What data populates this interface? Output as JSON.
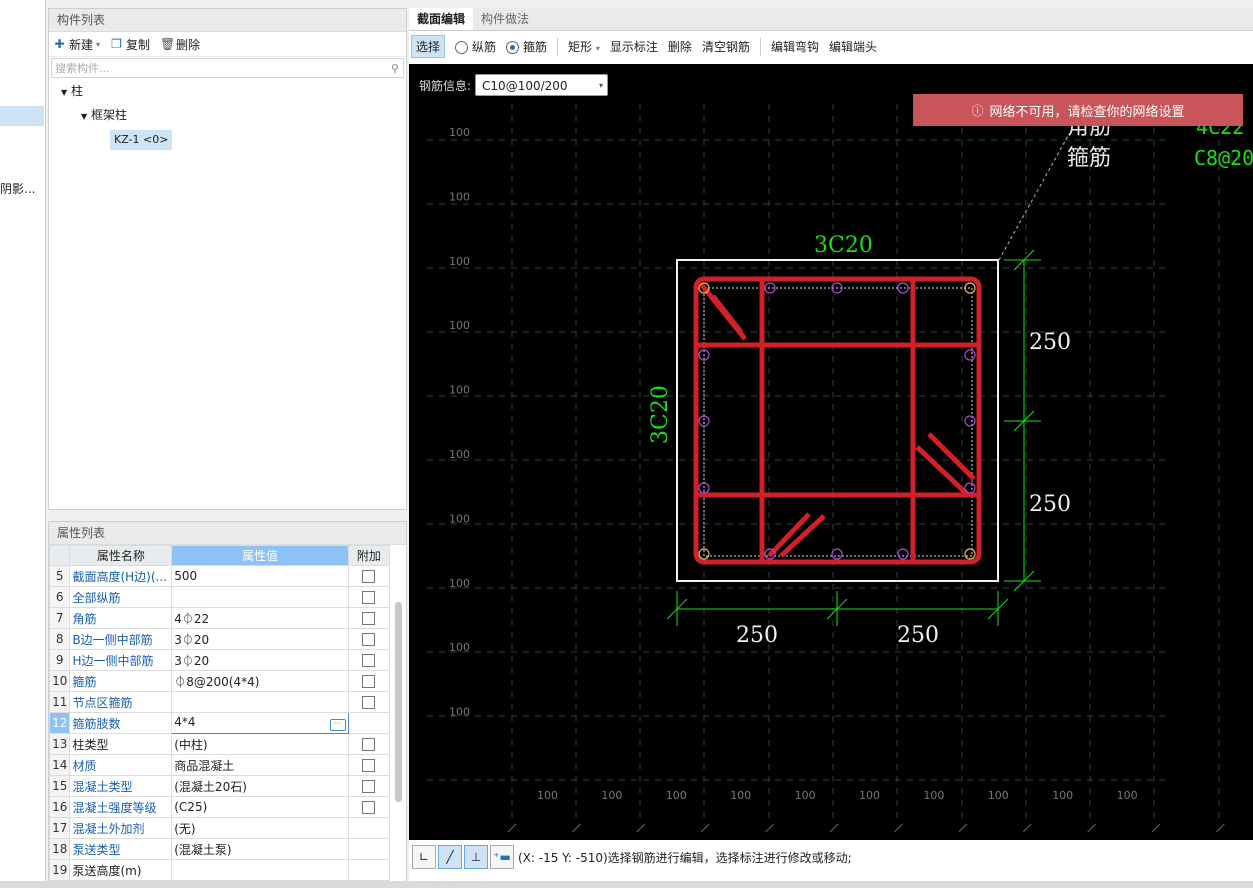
{
  "left_strip": {
    "text": "阴影..."
  },
  "component_list": {
    "title": "构件列表",
    "toolbar": {
      "new": "新建",
      "copy": "复制",
      "delete": "删除"
    },
    "search_placeholder": "搜索构件...",
    "tree": {
      "root": "柱",
      "child": "框架柱",
      "leaf": "KZ-1 <0>"
    }
  },
  "property_list": {
    "title": "属性列表",
    "headers": {
      "name": "属性名称",
      "value": "属性值",
      "extra": "附加"
    },
    "rows": [
      {
        "n": "5",
        "name": "截面高度(H边)(...",
        "value": "500",
        "checkbox": true,
        "link": true
      },
      {
        "n": "6",
        "name": "全部纵筋",
        "value": "",
        "checkbox": true,
        "link": true
      },
      {
        "n": "7",
        "name": "角筋",
        "value": "4⏀22",
        "checkbox": true,
        "link": true
      },
      {
        "n": "8",
        "name": "B边一侧中部筋",
        "value": "3⏀20",
        "checkbox": true,
        "link": true
      },
      {
        "n": "9",
        "name": "H边一侧中部筋",
        "value": "3⏀20",
        "checkbox": true,
        "link": true
      },
      {
        "n": "10",
        "name": "箍筋",
        "value": "⏀8@200(4*4)",
        "checkbox": true,
        "link": true
      },
      {
        "n": "11",
        "name": "节点区箍筋",
        "value": "",
        "checkbox": true,
        "link": true
      },
      {
        "n": "12",
        "name": "箍筋肢数",
        "value": "4*4",
        "checkbox": false,
        "link": true,
        "editing": true
      },
      {
        "n": "13",
        "name": "柱类型",
        "value": "(中柱)",
        "checkbox": true,
        "link": false
      },
      {
        "n": "14",
        "name": "材质",
        "value": "商品混凝土",
        "checkbox": true,
        "link": true
      },
      {
        "n": "15",
        "name": "混凝土类型",
        "value": "(混凝土20石)",
        "checkbox": true,
        "link": true
      },
      {
        "n": "16",
        "name": "混凝土强度等级",
        "value": "(C25)",
        "checkbox": true,
        "link": true
      },
      {
        "n": "17",
        "name": "混凝土外加剂",
        "value": "(无)",
        "checkbox": false,
        "link": true
      },
      {
        "n": "18",
        "name": "泵送类型",
        "value": "(混凝土泵)",
        "checkbox": false,
        "link": true
      },
      {
        "n": "19",
        "name": "泵送高度(m)",
        "value": "",
        "checkbox": false,
        "link": false
      }
    ]
  },
  "editor": {
    "tabs": [
      "截面编辑",
      "构件做法"
    ],
    "toolbar": {
      "select": "选择",
      "radio_long": "纵筋",
      "radio_stirrup": "箍筋",
      "shape": "矩形",
      "show_dims": "显示标注",
      "delete": "删除",
      "clear": "清空钢筋",
      "edit_hook": "编辑弯钩",
      "edit_end": "编辑端头"
    },
    "rebar_info_label": "钢筋信息:",
    "rebar_info_value": "C10@100/200",
    "toast": "网络不可用，请检查你的网络设置",
    "legend_lines": [
      "角筋",
      "箍筋"
    ],
    "legend_values": [
      "4C22",
      "C8@20"
    ],
    "top_label": "3C20",
    "left_label": "3C20",
    "dims": {
      "right_top": "250",
      "right_bottom": "250",
      "bottom_left": "250",
      "bottom_right": "250"
    },
    "grid_label": "100",
    "status_text": "(X: -15 Y: -510)选择钢筋进行编辑，选择标注进行修改或移动;"
  },
  "colors": {
    "rebar_red": "#d02028",
    "dim_green": "#18e018",
    "canvas_bg": "#000000",
    "toast_bg": "#c9545a"
  }
}
